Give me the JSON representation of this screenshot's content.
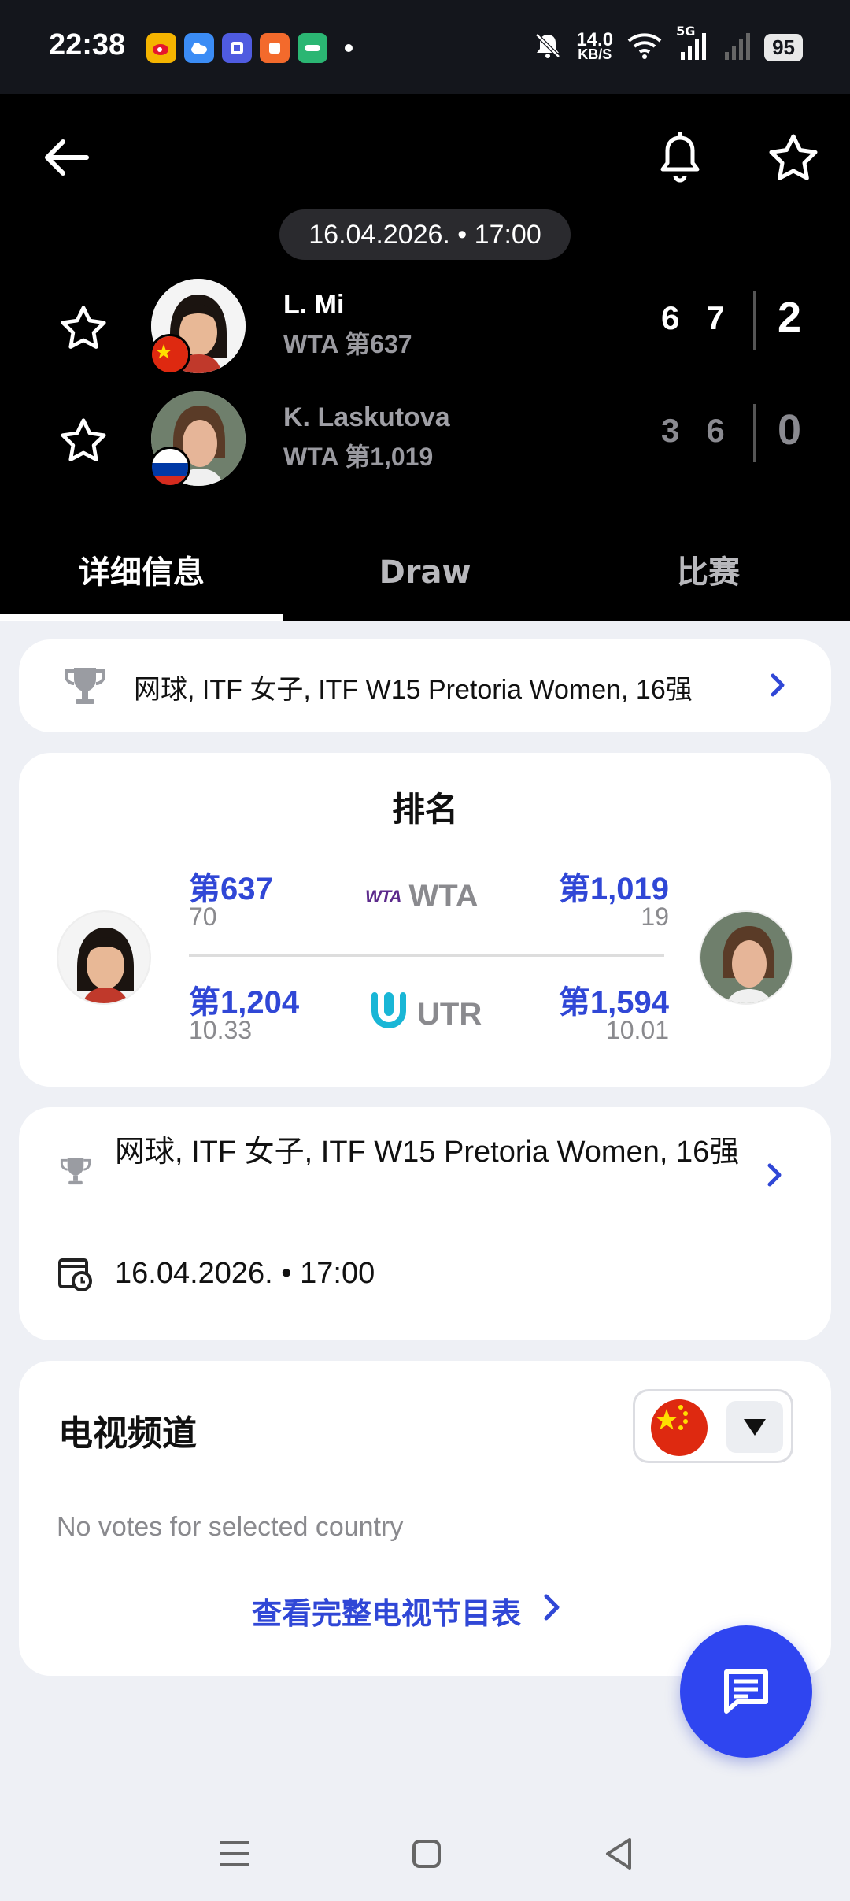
{
  "status_bar": {
    "time": "22:38",
    "net_speed_value": "14.0",
    "net_speed_unit": "KB/S",
    "network_type": "5G",
    "battery": "95",
    "icons": [
      "weibo-icon",
      "weather-icon",
      "tieba-icon",
      "app-icon",
      "oppo-icon",
      "notification-dot",
      "bell-off-icon",
      "wifi-icon",
      "signal-icon",
      "signal-icon-2"
    ]
  },
  "header": {
    "date_time": "16.04.2026. • 17:00",
    "players": [
      {
        "name": "L. Mi",
        "rank": "WTA 第637",
        "flag": "china",
        "sets": [
          "6",
          "7"
        ],
        "total": "2"
      },
      {
        "name": "K. Laskutova",
        "rank": "WTA 第1,019",
        "flag": "russia",
        "sets": [
          "3",
          "6"
        ],
        "total": "0"
      }
    ]
  },
  "tabs": [
    {
      "label": "详细信息",
      "active": true
    },
    {
      "label": "Draw",
      "active": false
    },
    {
      "label": "比赛",
      "active": false
    }
  ],
  "tournament": {
    "label": "网球, ITF 女子, ITF W15 Pretoria Women, 16强"
  },
  "rankings": {
    "title": "排名",
    "wta": {
      "name": "WTA",
      "mark": "WTA",
      "left_rank": "第637",
      "left_points": "70",
      "right_rank": "第1,019",
      "right_points": "19"
    },
    "utr": {
      "name": "UTR",
      "left_rank": "第1,204",
      "left_points": "10.33",
      "right_rank": "第1,594",
      "right_points": "10.01"
    }
  },
  "match_info": {
    "tournament": "网球, ITF 女子, ITF W15 Pretoria Women, 16强",
    "date_time": "16.04.2026. • 17:00"
  },
  "tv": {
    "title": "电视频道",
    "empty_text": "No votes for selected country",
    "link_label": "查看完整电视节目表",
    "selected_country": "china"
  },
  "colors": {
    "accent": "#3047d6",
    "fab": "#2f45f0",
    "header_bg": "#000000",
    "page_bg": "#eef0f5"
  }
}
